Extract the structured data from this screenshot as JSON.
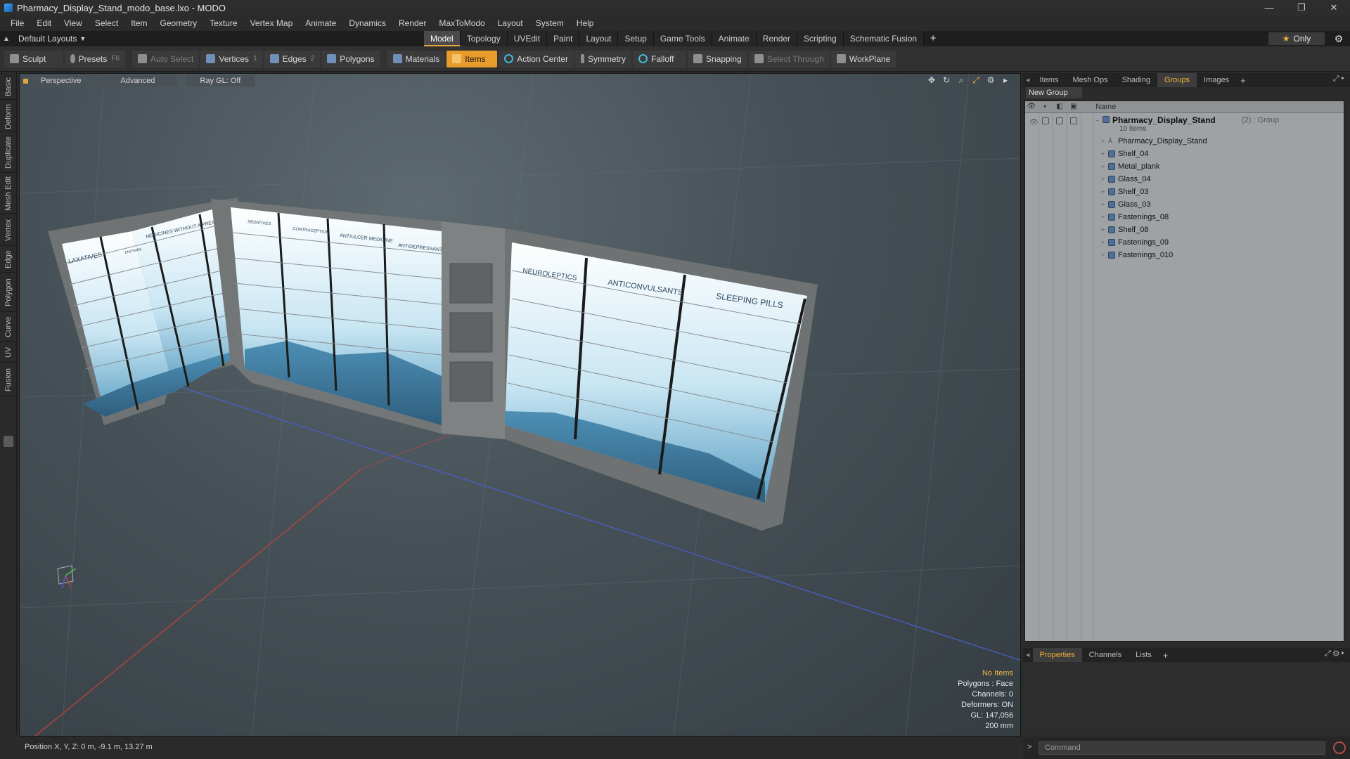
{
  "window": {
    "title": "Pharmacy_Display_Stand_modo_base.lxo - MODO",
    "controls": [
      "—",
      "❐",
      "✕"
    ]
  },
  "menu": [
    "File",
    "Edit",
    "View",
    "Select",
    "Item",
    "Geometry",
    "Texture",
    "Vertex Map",
    "Animate",
    "Dynamics",
    "Render",
    "MaxToModo",
    "Layout",
    "System",
    "Help"
  ],
  "layout_bar": {
    "layout_label": "Default Layouts",
    "tabs": [
      "Model",
      "Topology",
      "UVEdit",
      "Paint",
      "Layout",
      "Setup",
      "Game Tools",
      "Animate",
      "Render",
      "Scripting",
      "Schematic Fusion"
    ],
    "active_tab": "Model",
    "add_symbol": "+",
    "only_label": "Only"
  },
  "toolbar": {
    "sculpt": "Sculpt",
    "presets": "Presets",
    "presets_key": "F6",
    "auto_select": "Auto Select",
    "vertices": "Vertices",
    "vertices_key": "1",
    "edges": "Edges",
    "edges_key": "2",
    "polygons": "Polygons",
    "materials": "Materials",
    "items": "Items",
    "action_center": "Action Center",
    "symmetry": "Symmetry",
    "falloff": "Falloff",
    "snapping": "Snapping",
    "select_through": "Select Through",
    "workplane": "WorkPlane"
  },
  "left_tabs": [
    "Basic",
    "Deform",
    "Duplicate",
    "Mesh Edit",
    "Vertex",
    "Edge",
    "Polygon",
    "Curve",
    "UV",
    "Fusion"
  ],
  "viewport": {
    "view_mode": "Perspective",
    "shading": "Advanced",
    "raygl": "Ray GL: Off",
    "info": {
      "items": "No Items",
      "polygons": "Polygons : Face",
      "channels": "Channels: 0",
      "deformers": "Deformers: ON",
      "gl": "GL: 147,056",
      "scale": "200 mm"
    },
    "shelf_labels": {
      "laxatives": "LAXATIVES",
      "medicines_prescription": "MEDICINES WITHOUT A PRESCRIPTION",
      "small_label": "ENZYMES",
      "sedatives": "SEDATIVES",
      "contraception": "CONTRACEPTION",
      "antiulcer": "ANTIULCER MEDICINE",
      "antidepressants": "ANTIDEPRESSANTS",
      "neuroleptics": "NEUROLEPTICS",
      "anticonvulsants": "ANTICONVULSANTS",
      "sleeping_pills": "SLEEPING PILLS"
    },
    "axis_colors": {
      "x": "#c9413f",
      "y": "#4fbf4f",
      "z": "#4b5fd6"
    }
  },
  "status": {
    "position": "Position X, Y, Z:  0 m, -9.1 m, 13.27 m"
  },
  "right_panel": {
    "top_tabs": [
      "Items",
      "Mesh Ops",
      "Shading",
      "Groups",
      "Images"
    ],
    "active_top_tab": "Groups",
    "new_group": "New Group",
    "list_header": "Name",
    "group": {
      "name": "Pharmacy_Display_Stand",
      "extra": "(2) : Group",
      "count": "10 Items"
    },
    "items": [
      {
        "label": "Pharmacy_Display_Stand",
        "icon": "locator-icon"
      },
      {
        "label": "Shelf_04",
        "icon": "mesh-icon"
      },
      {
        "label": "Metal_plank",
        "icon": "mesh-icon"
      },
      {
        "label": "Glass_04",
        "icon": "mesh-icon"
      },
      {
        "label": "Shelf_03",
        "icon": "mesh-icon"
      },
      {
        "label": "Glass_03",
        "icon": "mesh-icon"
      },
      {
        "label": "Fastenings_08",
        "icon": "mesh-icon"
      },
      {
        "label": "Shelf_08",
        "icon": "mesh-icon"
      },
      {
        "label": "Fastenings_09",
        "icon": "mesh-icon"
      },
      {
        "label": "Fastenings_010",
        "icon": "mesh-icon"
      }
    ],
    "bottom_tabs": [
      "Properties",
      "Channels",
      "Lists"
    ],
    "active_bottom_tab": "Properties",
    "command_placeholder": "Command"
  }
}
